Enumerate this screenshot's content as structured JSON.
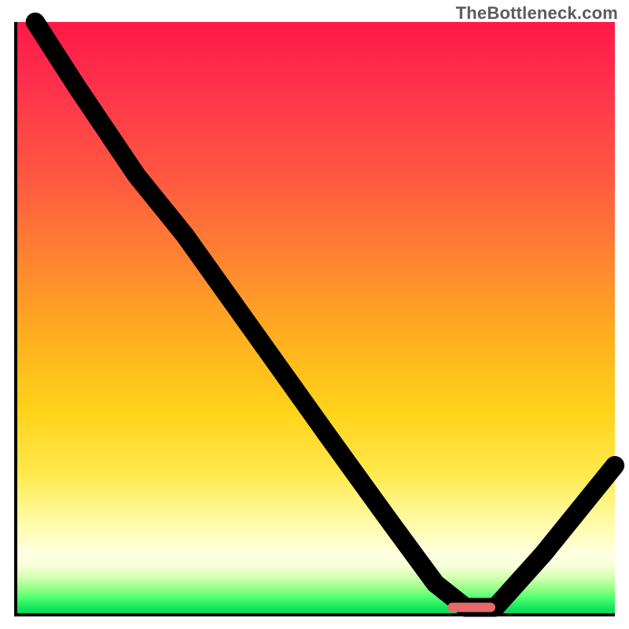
{
  "watermark": "TheBottleneck.com",
  "chart_data": {
    "type": "line",
    "title": "",
    "xlabel": "",
    "ylabel": "",
    "xlim": [
      0,
      100
    ],
    "ylim": [
      0,
      100
    ],
    "grid": false,
    "legend": false,
    "series": [
      {
        "name": "bottleneck-curve",
        "x": [
          3,
          10,
          20,
          28,
          40,
          52,
          62,
          70,
          75,
          80,
          88,
          100
        ],
        "values": [
          100,
          89,
          74,
          64,
          47,
          30,
          16,
          5,
          1,
          1,
          10,
          25
        ]
      }
    ],
    "marker": {
      "x_start": 72,
      "x_end": 80,
      "y": 0.7
    },
    "background_gradient": {
      "stops": [
        {
          "pos": 0,
          "color": "#ff1846"
        },
        {
          "pos": 0.55,
          "color": "#ffb41e"
        },
        {
          "pos": 0.86,
          "color": "#fffdba"
        },
        {
          "pos": 0.96,
          "color": "#8eff82"
        },
        {
          "pos": 1.0,
          "color": "#0fd858"
        }
      ]
    }
  }
}
